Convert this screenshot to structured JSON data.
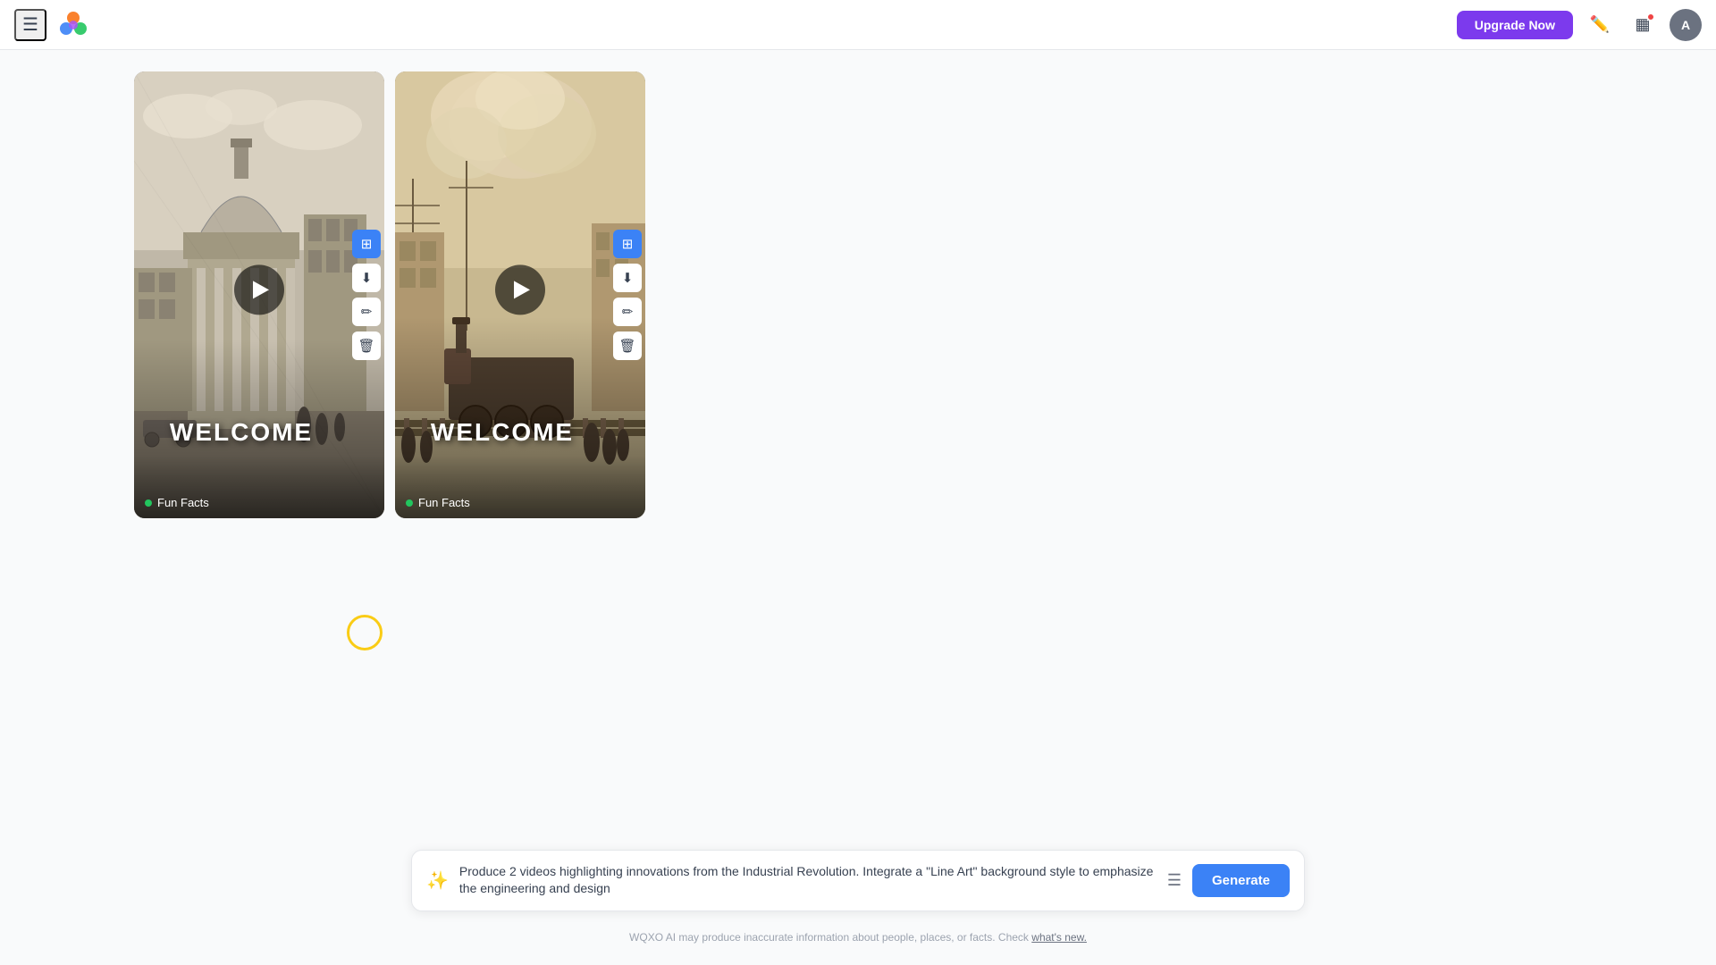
{
  "navbar": {
    "menu_icon": "☰",
    "upgrade_label": "Upgrade Now",
    "avatar_label": "A"
  },
  "cards": [
    {
      "id": "card-1",
      "title": "WELCOME",
      "label": "Fun Facts",
      "bg_type": "architecture-grayscale"
    },
    {
      "id": "card-2",
      "title": "WELCOME",
      "label": "Fun Facts",
      "bg_type": "train-sepia"
    }
  ],
  "prompt": {
    "text": "Produce 2 videos highlighting innovations from the Industrial Revolution. Integrate a \"Line Art\" background style to emphasize the engineering and design",
    "generate_label": "Generate"
  },
  "footer": {
    "note": "WQXO AI may produce inaccurate information about people, places, or facts. Check",
    "link_text": "what's new."
  }
}
